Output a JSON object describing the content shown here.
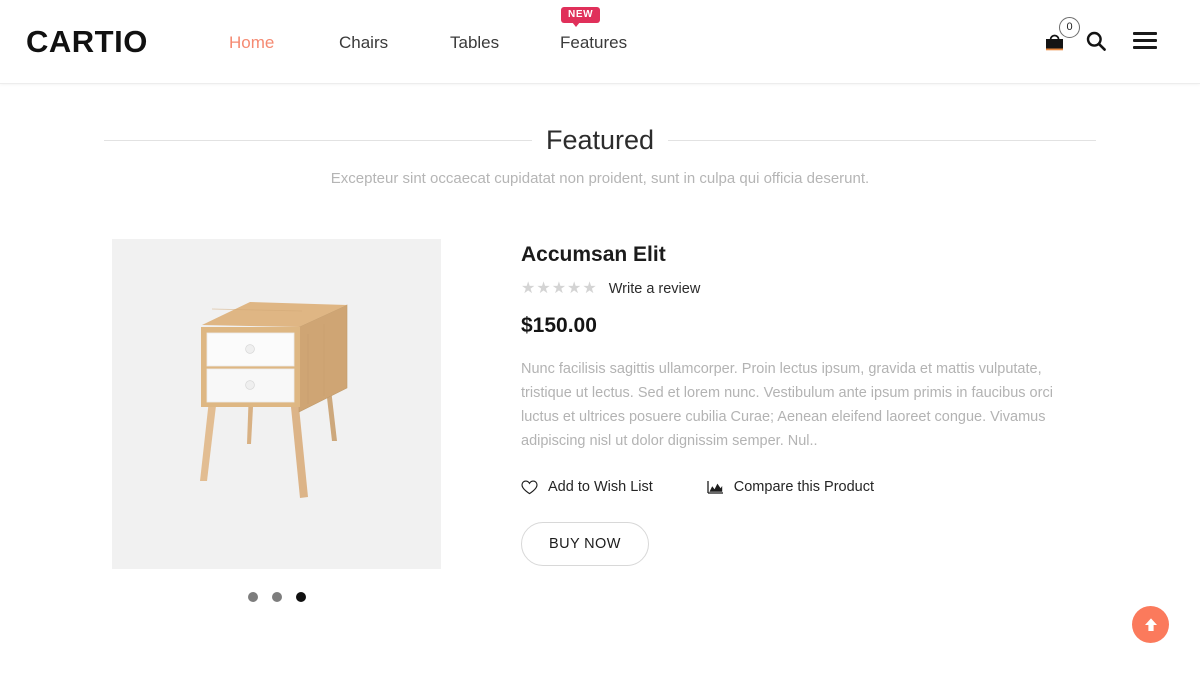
{
  "header": {
    "logo": "CARTIO",
    "nav": [
      {
        "label": "Home",
        "active": true
      },
      {
        "label": "Chairs",
        "active": false
      },
      {
        "label": "Tables",
        "active": false
      },
      {
        "label": "Features",
        "active": false,
        "badge": "NEW"
      }
    ],
    "cart_count": "0",
    "icons": {
      "cart": "shopping-bag-icon",
      "search": "search-icon",
      "menu": "hamburger-menu-icon"
    },
    "accent_color": "#f58a72",
    "badge_color": "#e0305a"
  },
  "section": {
    "title": "Featured",
    "subtitle": "Excepteur sint occaecat cupidatat non proident, sunt in culpa qui officia deserunt."
  },
  "product": {
    "title": "Accumsan Elit",
    "stars": [
      "★",
      "★",
      "★",
      "★",
      "★"
    ],
    "star_color": "#d4d4d4",
    "review_link": "Write a review",
    "price": "$150.00",
    "description": "Nunc facilisis sagittis ullamcorper. Proin lectus ipsum, gravida et mattis vulputate, tristique ut lectus. Sed et lorem nunc. Vestibulum ante ipsum primis in faucibus orci luctus et ultrices posuere cubilia Curae; Aenean eleifend laoreet congue. Vivamus adipiscing nisl ut dolor dignissim semper. Nul..",
    "wishlist_label": "Add to Wish List",
    "compare_label": "Compare this Product",
    "buy_label": "BUY NOW",
    "image_alt": "wooden nightstand with two white drawers",
    "image_bg": "#f1f1f1",
    "carousel_dots": [
      {
        "active": false
      },
      {
        "active": false
      },
      {
        "active": true
      }
    ]
  },
  "scroll_top": {
    "icon": "arrow-up-icon",
    "color": "#fb7a5c"
  }
}
